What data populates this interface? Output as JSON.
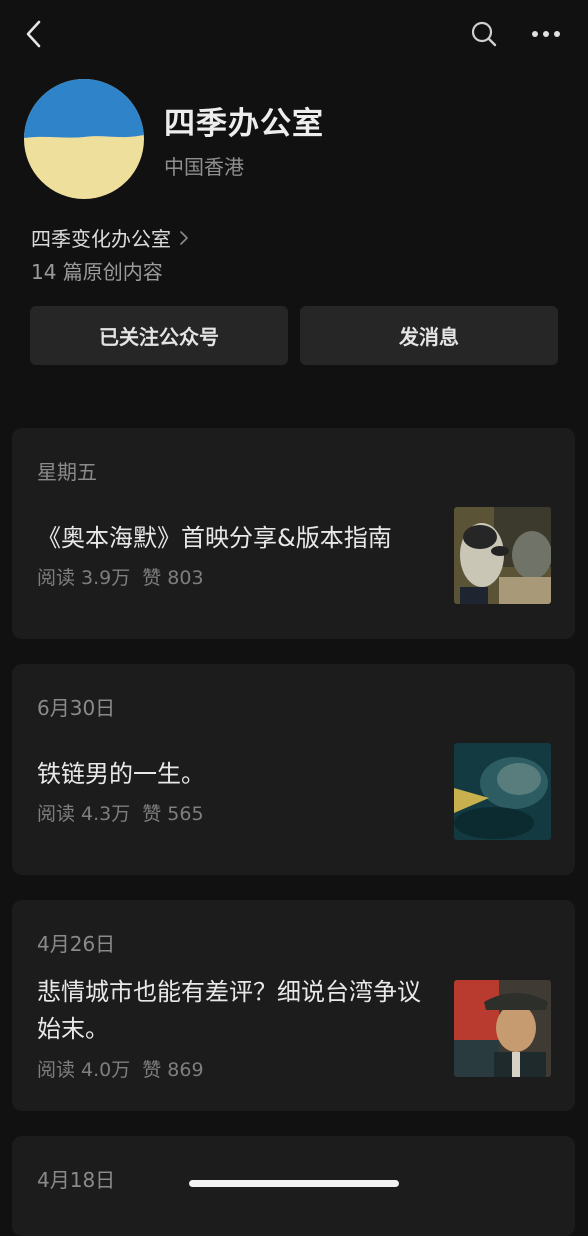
{
  "nav": {
    "back_icon": "chevron-left-icon",
    "search_icon": "search-icon",
    "more_icon": "more-dots-icon"
  },
  "profile": {
    "name": "四季办公室",
    "region": "中国香港",
    "description": "四季变化办公室",
    "article_count": "14 篇原创内容",
    "avatar_colors": {
      "top": "#2f83c9",
      "bottom": "#efdf9c"
    }
  },
  "actions": {
    "followed_label": "已关注公众号",
    "message_label": "发消息"
  },
  "articles": [
    {
      "date": "星期五",
      "title": "《奥本海默》首映分享&版本指南",
      "reads": "阅读 3.9万",
      "likes": "赞 803"
    },
    {
      "date": "6月30日",
      "title": "铁链男的一生。",
      "reads": "阅读 4.3万",
      "likes": "赞 565"
    },
    {
      "date": "4月26日",
      "title": "悲情城市也能有差评？细说台湾争议始末。",
      "reads": "阅读 4.0万",
      "likes": "赞 869"
    },
    {
      "date": "4月18日"
    }
  ]
}
